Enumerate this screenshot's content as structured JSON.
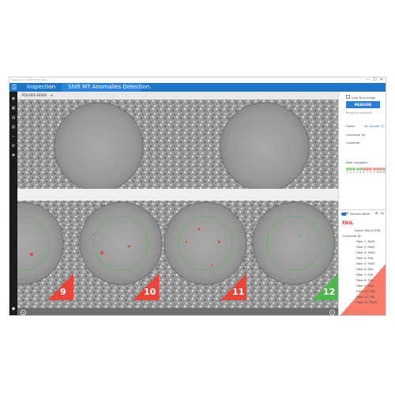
{
  "window": {
    "title": "Xtavision 1.1.2.4574 by Xtera",
    "section": "Inspection",
    "app_title": "Shift MT Anomalies Detection.",
    "controls": [
      "—",
      "☐",
      "✕"
    ]
  },
  "toolbar": {
    "device": "POLARIS 60000",
    "chevron": "▾"
  },
  "sidebar": {
    "icons": [
      "menu-icon",
      "circle-icon",
      "image-icon",
      "book-icon",
      "layers-icon",
      "link-icon",
      "settings-icon",
      "team-icon",
      "user-icon"
    ]
  },
  "right_panel": {
    "auto_tune": "Auto Tune Image",
    "measure_button": "MEASURE",
    "status": "Ready to measure",
    "folder_label": "Folder",
    "folder_value": "My Results",
    "connector_id_label": "Connector ID:",
    "customer_label": "Customer:",
    "fiber_navigator": "Fiber navigator",
    "fiber_numbers": [
      "1",
      "2",
      "3",
      "4",
      "5",
      "6",
      "7",
      "8",
      "9",
      "10",
      "11",
      "12"
    ],
    "fiber_colors": [
      "#8fd18f",
      "#8fd18f",
      "#8fd18f",
      "#8fd18f",
      "#8fd18f",
      "#f39a9a",
      "#f39a9a",
      "#f39a9a",
      "#f39a9a",
      "#f39a9a",
      "#f39a9a",
      "#8fd18f"
    ],
    "express_mode": "Express Mode",
    "result": "FAIL",
    "name_label": "Name: Res-h1296",
    "connector_label": "Connector ID:",
    "results": [
      "Fiber 1: PASS",
      "Fiber 2: PASS",
      "Fiber 3: PASS",
      "Fiber 4: FAIL",
      "Fiber 5: PASS",
      "Fiber 6: FAIL",
      "Fiber 7: FAIL",
      "Fiber 8: FAIL",
      "Fiber 9: FAIL",
      "Fiber 10: FAIL",
      "Fiber 11: FAIL",
      "Fiber 12: PASS"
    ]
  },
  "fibers": {
    "labels": [
      "9",
      "10",
      "11",
      "12"
    ],
    "colors": [
      "#e8463a",
      "#e8463a",
      "#e8463a",
      "#4fb54f"
    ]
  }
}
